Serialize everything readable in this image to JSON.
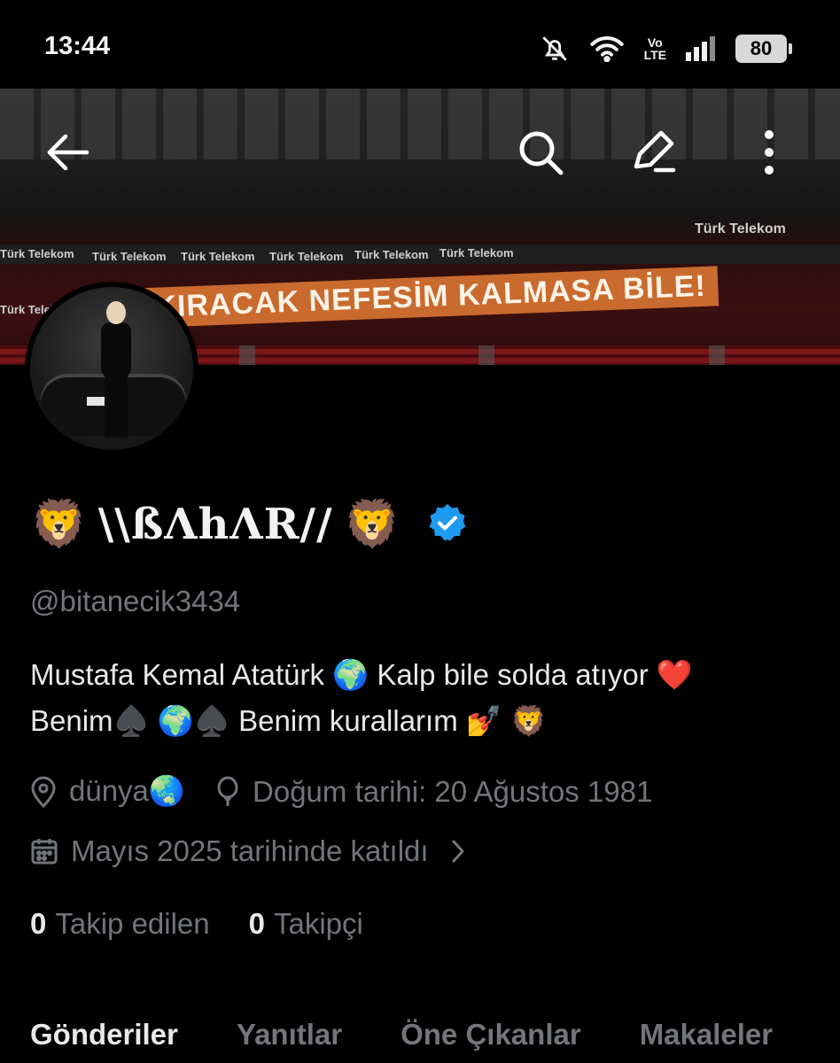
{
  "status_bar": {
    "time": "13:44",
    "network_label_top": "Vo",
    "network_label_bottom": "LTE",
    "battery": "80"
  },
  "banner": {
    "sponsor_text": "Türk Telekom",
    "slogan": "HAYKIRACAK NEFESİM KALMASA BİLE!",
    "icons": [
      "back-arrow-icon",
      "search-icon",
      "edit-icon",
      "more-vertical-icon"
    ]
  },
  "profile": {
    "name_emoji_left": "🦁",
    "name_text": "\\\\ßΛhΛR//",
    "name_emoji_right": "🦁",
    "verified": true,
    "verified_color": "#1d9bf0",
    "handle": "@bitanecik3434",
    "bio": "Mustafa Kemal Atatürk 🌍 Kalp bile solda atıyor ❤️ Benim♠️ 🌍♠️ Benim kurallarım 💅 🦁",
    "location": "dünya🌏",
    "birthday": "Doğum tarihi: 20 Ağustos 1981",
    "joined": "Mayıs 2025 tarihinde katıldı",
    "following_count": "0",
    "following_label": "Takip edilen",
    "followers_count": "0",
    "followers_label": "Takipçi"
  },
  "tabs": [
    {
      "label": "Gönderiler",
      "active": true
    },
    {
      "label": "Yanıtlar",
      "active": false
    },
    {
      "label": "Öne Çıkanlar",
      "active": false
    },
    {
      "label": "Makaleler",
      "active": false
    }
  ],
  "colors": {
    "background": "#000000",
    "primary_text": "#e7e9ea",
    "secondary_text": "#71767b",
    "accent": "#1d9bf0"
  }
}
